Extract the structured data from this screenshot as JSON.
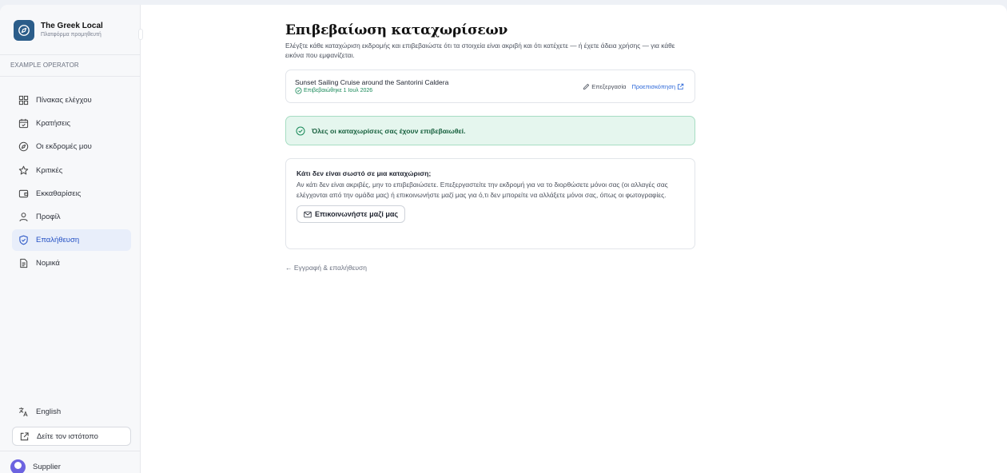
{
  "sidebar": {
    "brand_title": "The Greek Local",
    "brand_subtitle": "Πλατφόρμα προμηθευτή",
    "operator": "EXAMPLE OPERATOR",
    "items": [
      {
        "label": "Πίνακας ελέγχου",
        "icon": "dashboard-icon"
      },
      {
        "label": "Κρατήσεις",
        "icon": "calendar-icon"
      },
      {
        "label": "Οι εκδρομές μου",
        "icon": "compass-icon"
      },
      {
        "label": "Κριτικές",
        "icon": "star-icon"
      },
      {
        "label": "Εκκαθαρίσεις",
        "icon": "wallet-icon"
      },
      {
        "label": "Προφίλ",
        "icon": "user-icon"
      },
      {
        "label": "Επαλήθευση",
        "icon": "shield-check-icon"
      },
      {
        "label": "Νομικά",
        "icon": "document-icon"
      }
    ],
    "active_item": "Επαλήθευση",
    "language": "English",
    "site_button": "Δείτε τον ιστότοπο",
    "user_name": "Supplier"
  },
  "main": {
    "title": "Επιβεβαίωση καταχωρίσεων",
    "description": "Ελέγξτε κάθε καταχώριση εκδρομής και επιβεβαιώστε ότι τα στοιχεία είναι ακριβή και ότι κατέχετε — ή έχετε άδεια χρήσης — για κάθε εικόνα που εμφανίζεται.",
    "listing": {
      "title": "Sunset Sailing Cruise around the Santorini Caldera",
      "status": "Επιβεβαιώθηκε 1 Ιουλ 2026",
      "edit_label": "Επεξεργασία",
      "preview_label": "Προεπισκόπηση"
    },
    "success_message": "Όλες οι καταχωρίσεις σας έχουν επιβεβαιωθεί.",
    "help": {
      "title": "Κάτι δεν είναι σωστό σε μια καταχώριση;",
      "text": "Αν κάτι δεν είναι ακριβές, μην το επιβεβαιώσετε. Επεξεργαστείτε την εκδρομή για να το διορθώσετε μόνοι σας (οι αλλαγές σας ελέγχονται από την ομάδα μας) ή επικοινωνήστε μαζί μας για ό,τι δεν μπορείτε να αλλάξετε μόνοι σας, όπως οι φωτογραφίες.",
      "contact_label": "Επικοινωνήστε μαζί μας"
    },
    "back_link": "← Εγγραφή & επαλήθευση"
  },
  "colors": {
    "accent": "#2350c4",
    "brand": "#2b5d8a",
    "success_bg": "#e5f6ee",
    "success_text": "#17603e"
  }
}
